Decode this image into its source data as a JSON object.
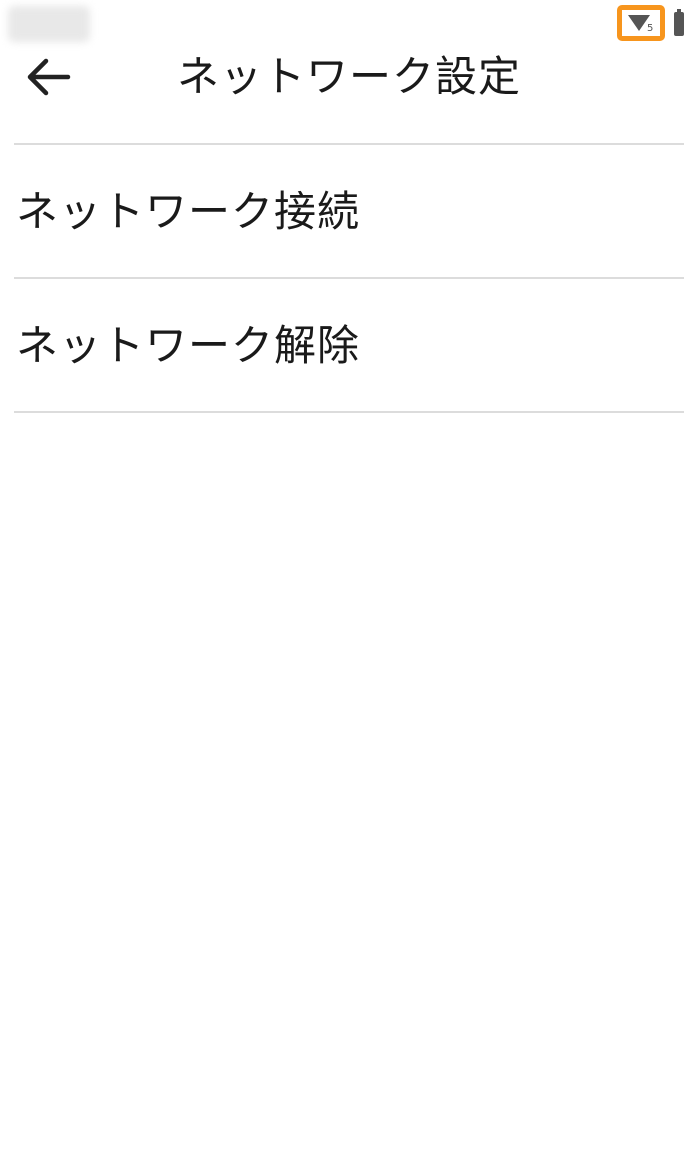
{
  "status_bar": {
    "wifi_badge": "5",
    "wifi_icon": "wifi-5g-icon",
    "highlight_color": "#f7951d"
  },
  "header": {
    "title": "ネットワーク設定",
    "back_icon": "arrow-left-icon"
  },
  "menu": {
    "items": [
      {
        "label": "ネットワーク接続"
      },
      {
        "label": "ネットワーク解除"
      }
    ]
  }
}
